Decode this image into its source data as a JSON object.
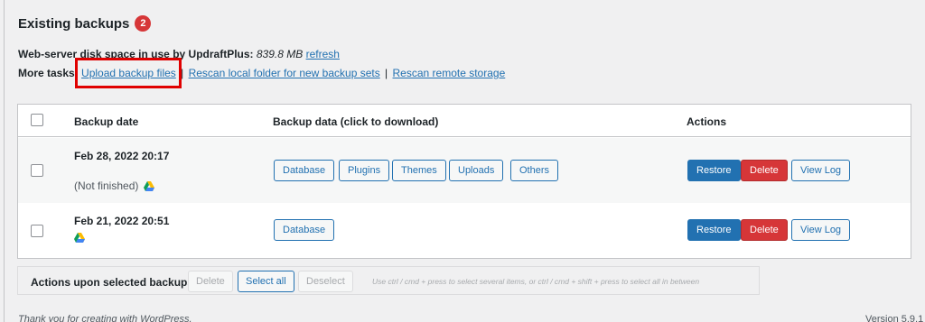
{
  "section": {
    "title": "Existing backups",
    "count": "2"
  },
  "disk": {
    "label": "Web-server disk space in use by UpdraftPlus:",
    "value": "839.8 MB",
    "refresh_link": "refresh"
  },
  "tasks": {
    "label": "More tasks:",
    "upload_link": "Upload backup files",
    "rescan_local_link": "Rescan local folder for new backup sets",
    "separator": "|",
    "rescan_remote_link": "Rescan remote storage"
  },
  "table": {
    "headers": {
      "date": "Backup date",
      "data": "Backup data (click to download)",
      "actions": "Actions"
    },
    "rows": [
      {
        "date": "Feb 28, 2022 20:17",
        "note": "(Not finished)",
        "data_buttons": [
          "Database",
          "Plugins",
          "Themes",
          "Uploads",
          "Others"
        ],
        "restore": "Restore",
        "delete": "Delete",
        "view_log": "View Log"
      },
      {
        "date": "Feb 21, 2022 20:51",
        "note": "",
        "data_buttons": [
          "Database"
        ],
        "restore": "Restore",
        "delete": "Delete",
        "view_log": "View Log"
      }
    ]
  },
  "bulk": {
    "label": "Actions upon selected backups",
    "delete": "Delete",
    "select_all": "Select all",
    "deselect": "Deselect",
    "hint": "Use ctrl / cmd + press to select several items, or ctrl / cmd + shift + press to select all in between"
  },
  "footer": {
    "left": "Thank you for creating with WordPress.",
    "right": "Version 5.9.1"
  },
  "colors": {
    "accent": "#2271b1",
    "danger": "#d63638",
    "highlight": "#e00000"
  },
  "icons": {
    "cloud_storage": "google-drive-icon"
  }
}
